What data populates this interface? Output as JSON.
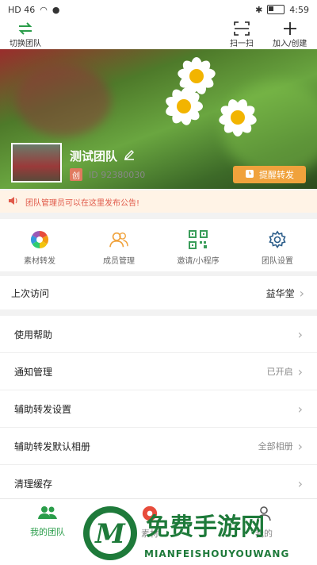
{
  "status": {
    "left": "HD 46",
    "time": "4:59"
  },
  "topbar": {
    "switch_team": "切换团队",
    "scan": "扫一扫",
    "join_create": "加入/创建"
  },
  "team": {
    "name": "测试团队",
    "tag": "创",
    "id": "ID 92380030",
    "remind_button": "提醒转发"
  },
  "notice": {
    "text": "团队管理员可以在这里发布公告!"
  },
  "features": [
    {
      "label": "素材转发",
      "icon": "aperture-icon"
    },
    {
      "label": "成员管理",
      "icon": "members-icon"
    },
    {
      "label": "邀请/小程序",
      "icon": "qrcode-icon"
    },
    {
      "label": "团队设置",
      "icon": "gear-icon"
    }
  ],
  "last_visit": {
    "label": "上次访问",
    "value": "益华堂"
  },
  "menu": [
    {
      "label": "使用帮助",
      "value": ""
    },
    {
      "label": "通知管理",
      "value": "已开启"
    },
    {
      "label": "辅助转发设置",
      "value": ""
    },
    {
      "label": "辅助转发默认相册",
      "value": "全部相册"
    },
    {
      "label": "清理缓存",
      "value": ""
    }
  ],
  "bottom_nav": {
    "my_team": "我的团队",
    "middle": "素材",
    "right": "我的"
  },
  "watermark": {
    "cn": "免费手游网",
    "en": "MIANFEISHOUYOUWANG"
  },
  "colors": {
    "accent_green": "#2a9d4a",
    "accent_orange": "#f0a23c",
    "notice_red": "#e05a4a"
  }
}
